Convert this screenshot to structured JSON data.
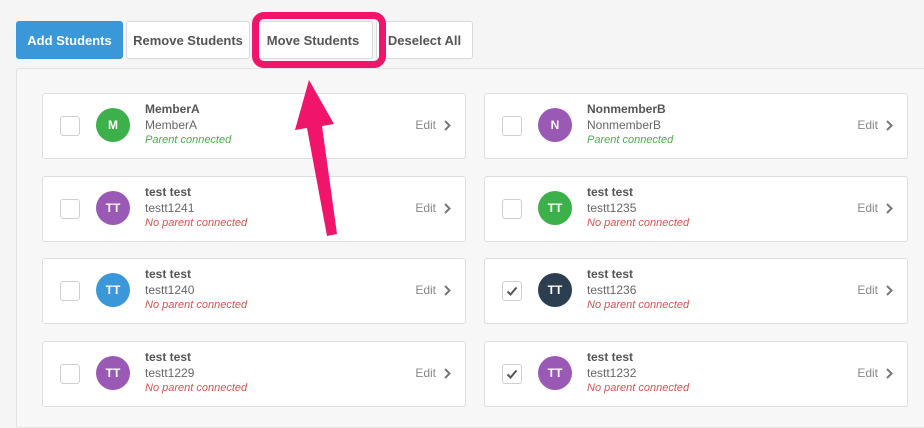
{
  "toolbar": {
    "add_label": "Add Students",
    "remove_label": "Remove Students",
    "move_label": "Move Students",
    "deselect_label": "Deselect All"
  },
  "colors": {
    "primary": "#3a97d8",
    "highlight": "#f0156a",
    "connected": "#4cae4c",
    "not_connected": "#d9534f"
  },
  "students": [
    {
      "name": "MemberA",
      "username": "MemberA",
      "initials": "M",
      "status": "Parent connected",
      "connected": true,
      "checked": false,
      "avatar_color": "#3cb04b",
      "edit_label": "Edit"
    },
    {
      "name": "NonmemberB",
      "username": "NonmemberB",
      "initials": "N",
      "status": "Parent connected",
      "connected": true,
      "checked": false,
      "avatar_color": "#9b59b6",
      "edit_label": "Edit"
    },
    {
      "name": "test test",
      "username": "testt1241",
      "initials": "TT",
      "status": "No parent connected",
      "connected": false,
      "checked": false,
      "avatar_color": "#9b59b6",
      "edit_label": "Edit"
    },
    {
      "name": "test test",
      "username": "testt1235",
      "initials": "TT",
      "status": "No parent connected",
      "connected": false,
      "checked": false,
      "avatar_color": "#3cb04b",
      "edit_label": "Edit"
    },
    {
      "name": "test test",
      "username": "testt1240",
      "initials": "TT",
      "status": "No parent connected",
      "connected": false,
      "checked": false,
      "avatar_color": "#3a97d8",
      "edit_label": "Edit"
    },
    {
      "name": "test test",
      "username": "testt1236",
      "initials": "TT",
      "status": "No parent connected",
      "connected": false,
      "checked": true,
      "avatar_color": "#2c3e50",
      "edit_label": "Edit"
    },
    {
      "name": "test test",
      "username": "testt1229",
      "initials": "TT",
      "status": "No parent connected",
      "connected": false,
      "checked": false,
      "avatar_color": "#9b59b6",
      "edit_label": "Edit"
    },
    {
      "name": "test test",
      "username": "testt1232",
      "initials": "TT",
      "status": "No parent connected",
      "connected": false,
      "checked": true,
      "avatar_color": "#9b59b6",
      "edit_label": "Edit"
    }
  ]
}
